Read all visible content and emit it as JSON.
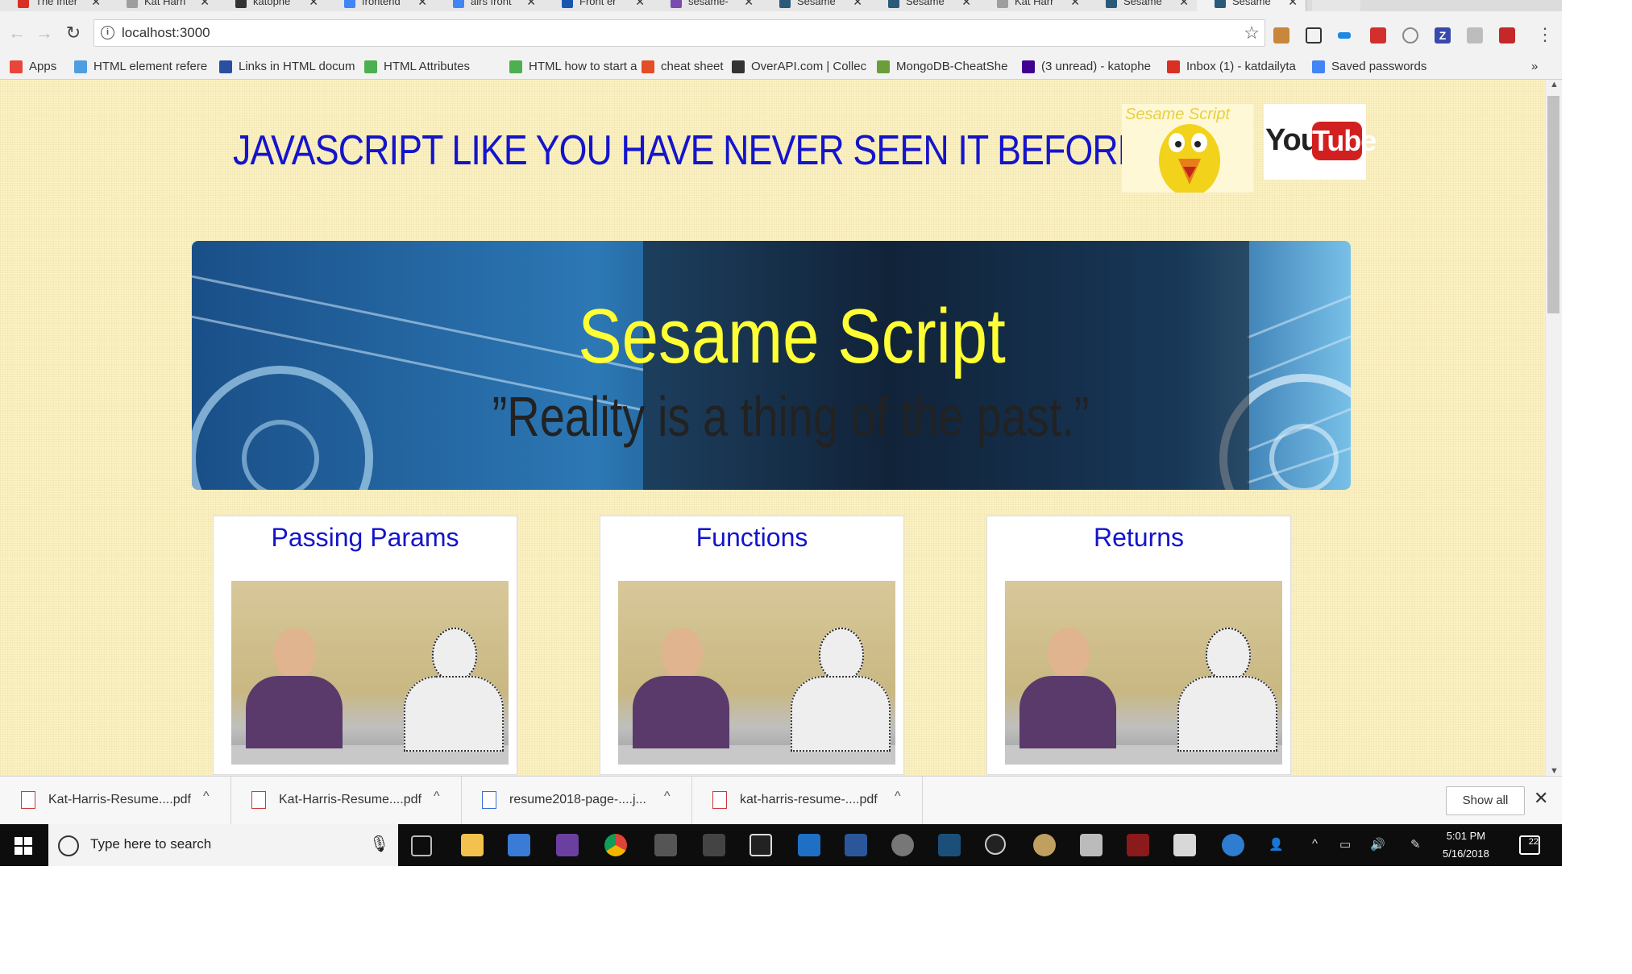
{
  "browser": {
    "tabs": [
      {
        "title": "The Inter",
        "color": "#d93025"
      },
      {
        "title": "Kat Harri",
        "color": "#9e9e9e"
      },
      {
        "title": "katophe",
        "color": "#333333"
      },
      {
        "title": "frontend",
        "color": "#4285f4"
      },
      {
        "title": "airs front",
        "color": "#4285f4"
      },
      {
        "title": "Front er",
        "color": "#1a56b0"
      },
      {
        "title": "sesame-",
        "color": "#7b4bb0"
      },
      {
        "title": "Sesame",
        "color": "#2a5a7a"
      },
      {
        "title": "Sesame",
        "color": "#2a5a7a"
      },
      {
        "title": "Kat Harr",
        "color": "#9e9e9e"
      },
      {
        "title": "Sesame",
        "color": "#2a5a7a"
      },
      {
        "title": "Sesame",
        "color": "#2a5a7a"
      }
    ],
    "tab_close_glyph": "✕",
    "url": "localhost:3000",
    "bookmarks": [
      {
        "label": "Apps",
        "icon": "apps-grid-icon",
        "color": "#e8453c"
      },
      {
        "label": "HTML element refere",
        "icon": "page-icon",
        "color": "#4f9fe0"
      },
      {
        "label": "Links in HTML docum",
        "icon": "w3-icon",
        "color": "#2b4fa0"
      },
      {
        "label": "HTML Attributes",
        "icon": "w3schools-icon",
        "color": "#4caf50"
      },
      {
        "label": "HTML how to start a",
        "icon": "w3schools-icon",
        "color": "#4caf50"
      },
      {
        "label": "cheat sheet",
        "icon": "html5-icon",
        "color": "#e44d26"
      },
      {
        "label": "OverAPI.com | Collec",
        "icon": "overapi-icon",
        "color": "#333333"
      },
      {
        "label": "MongoDB-CheatShe",
        "icon": "mongodb-icon",
        "color": "#6b9e3a"
      },
      {
        "label": "(3 unread) - katophe",
        "icon": "yahoo-icon",
        "color": "#400090"
      },
      {
        "label": "Inbox (1) - katdailyta",
        "icon": "gmail-icon",
        "color": "#d93025"
      },
      {
        "label": "Saved passwords",
        "icon": "google-icon",
        "color": "#4285f4"
      }
    ],
    "bookmarks_overflow": "»"
  },
  "page": {
    "headline": "JAVASCRIPT LIKE YOU HAVE NEVER SEEN IT BEFORE",
    "sesame_logo_text": "Sesame Script",
    "youtube_you": "You",
    "youtube_tube": "Tube",
    "banner_title": "Sesame Script",
    "banner_tagline": "”Reality is a thing of the past.”",
    "cards": [
      {
        "title": "Passing Params"
      },
      {
        "title": "Functions"
      },
      {
        "title": "Returns"
      }
    ]
  },
  "downloads": {
    "items": [
      {
        "name": "Kat-Harris-Resume....pdf",
        "icon": "pdf-icon"
      },
      {
        "name": "Kat-Harris-Resume....pdf",
        "icon": "pdf-icon"
      },
      {
        "name": "resume2018-page-....j...",
        "icon": "image-file-icon"
      },
      {
        "name": "kat-harris-resume-....pdf",
        "icon": "pdf-icon"
      }
    ],
    "show_all": "Show all"
  },
  "taskbar": {
    "search_placeholder": "Type here to search",
    "time": "5:01 PM",
    "date": "5/16/2018",
    "notification_count": "22"
  }
}
